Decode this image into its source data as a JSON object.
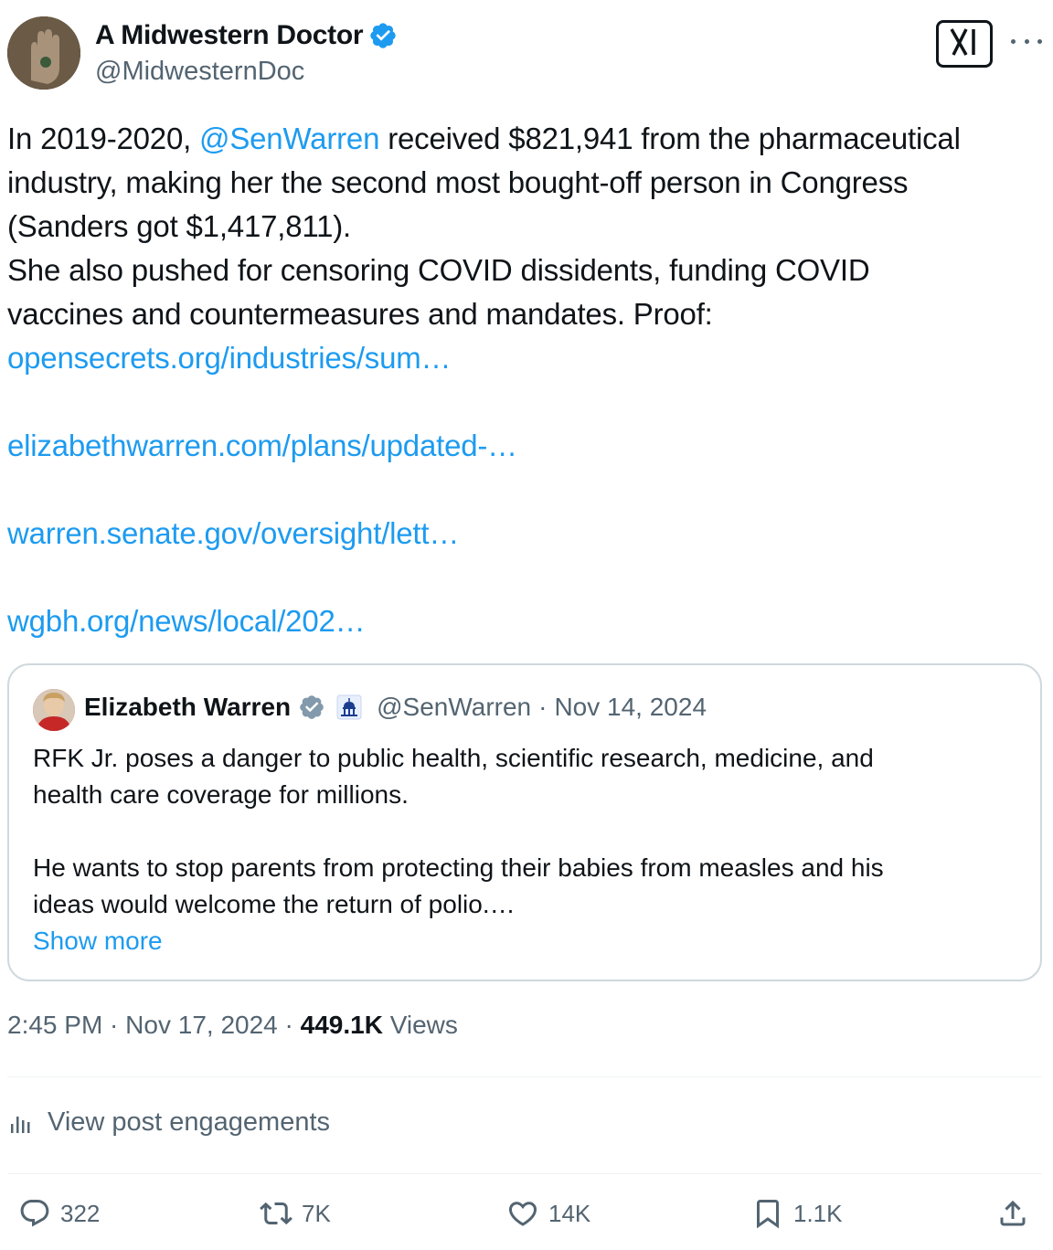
{
  "author": {
    "display_name": "A Midwestern Doctor",
    "handle": "@MidwesternDoc"
  },
  "tweet": {
    "lines": [
      {
        "pre": "In 2019-2020, ",
        "mention": "@SenWarren",
        "post": " received $821,941 from the pharmaceutical"
      },
      "industry, making her the second most bought-off person in Congress",
      "(Sanders got $1,417,811).",
      "She also pushed for censoring COVID dissidents, funding COVID",
      "vaccines and countermeasures and mandates. Proof:"
    ],
    "links": [
      "opensecrets.org/industries/sum…",
      "elizabethwarren.com/plans/updated-…",
      "warren.senate.gov/oversight/lett…",
      "wgbh.org/news/local/202…"
    ]
  },
  "quote": {
    "display_name": "Elizabeth Warren",
    "handle": "@SenWarren",
    "separator": "·",
    "date": "Nov 14, 2024",
    "paragraph1": [
      "RFK Jr. poses a danger to public health, scientific research, medicine, and",
      "health care coverage for millions."
    ],
    "paragraph2": [
      "He wants to stop parents from protecting their babies from measles and his",
      "ideas would welcome the return of polio.…"
    ],
    "show_more": "Show more"
  },
  "meta": {
    "time": "2:45 PM",
    "sep1": " · ",
    "date": "Nov 17, 2024",
    "sep2": " · ",
    "views_count": "449.1K",
    "views_label": " Views"
  },
  "engagements_label": "View post engagements",
  "actions": {
    "replies": "322",
    "reposts": "7K",
    "likes": "14K",
    "bookmarks": "1.1K"
  },
  "colors": {
    "link": "#1d9bf0",
    "text": "#0f1419",
    "secondary": "#536471",
    "border": "#cfd9de"
  },
  "icons": [
    "verified-badge-icon",
    "grok-icon",
    "more-icon",
    "gray-verified-badge-icon",
    "government-icon",
    "analytics-icon",
    "reply-icon",
    "repost-icon",
    "like-icon",
    "bookmark-icon",
    "share-icon"
  ]
}
